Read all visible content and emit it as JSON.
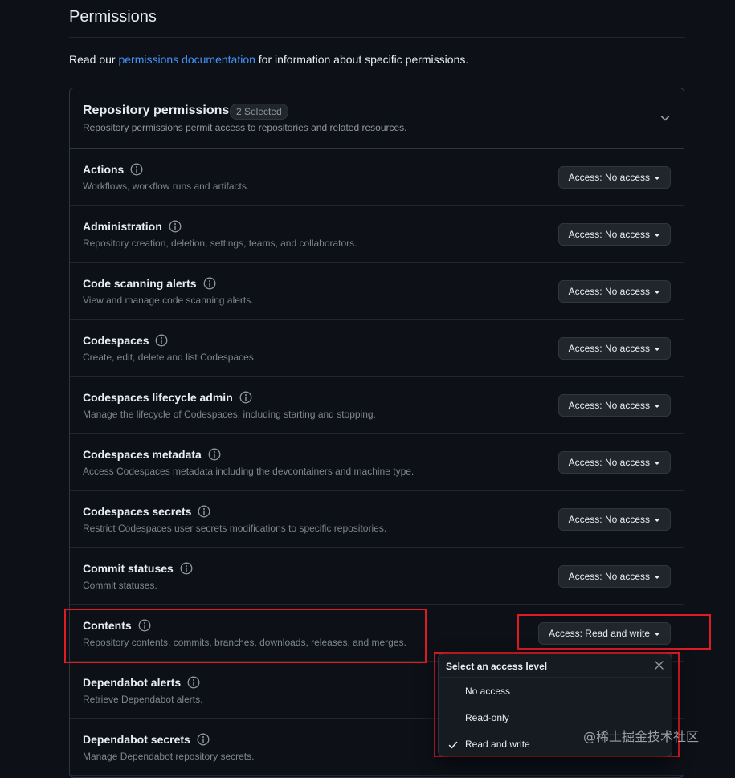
{
  "page": {
    "title": "Permissions",
    "intro_prefix": "Read our ",
    "intro_link": "permissions documentation",
    "intro_suffix": " for information about specific permissions."
  },
  "repository_permissions": {
    "title": "Repository permissions",
    "badge": "2 Selected",
    "description": "Repository permissions permit access to repositories and related resources.",
    "expand_icon": "chevron-down-icon",
    "rows": [
      {
        "name": "Actions",
        "description": "Workflows, workflow runs and artifacts.",
        "access": "Access: No access"
      },
      {
        "name": "Administration",
        "description": "Repository creation, deletion, settings, teams, and collaborators.",
        "access": "Access: No access"
      },
      {
        "name": "Code scanning alerts",
        "description": "View and manage code scanning alerts.",
        "access": "Access: No access"
      },
      {
        "name": "Codespaces",
        "description": "Create, edit, delete and list Codespaces.",
        "access": "Access: No access"
      },
      {
        "name": "Codespaces lifecycle admin",
        "description": "Manage the lifecycle of Codespaces, including starting and stopping.",
        "access": "Access: No access"
      },
      {
        "name": "Codespaces metadata",
        "description": "Access Codespaces metadata including the devcontainers and machine type.",
        "access": "Access: No access"
      },
      {
        "name": "Codespaces secrets",
        "description": "Restrict Codespaces user secrets modifications to specific repositories.",
        "access": "Access: No access"
      },
      {
        "name": "Commit statuses",
        "description": "Commit statuses.",
        "access": "Access: No access"
      },
      {
        "name": "Contents",
        "description": "Repository contents, commits, branches, downloads, releases, and merges.",
        "access": "Access: Read and write"
      },
      {
        "name": "Dependabot alerts",
        "description": "Retrieve Dependabot alerts.",
        "access": ""
      },
      {
        "name": "Dependabot secrets",
        "description": "Manage Dependabot repository secrets.",
        "access": ""
      }
    ]
  },
  "access_menu": {
    "title": "Select an access level",
    "options": [
      "No access",
      "Read-only",
      "Read and write"
    ],
    "selected": "Read and write"
  },
  "watermark": "@稀土掘金技术社区",
  "colors": {
    "background": "#0d1117",
    "link": "#4493f8",
    "highlight": "#e01b24"
  }
}
